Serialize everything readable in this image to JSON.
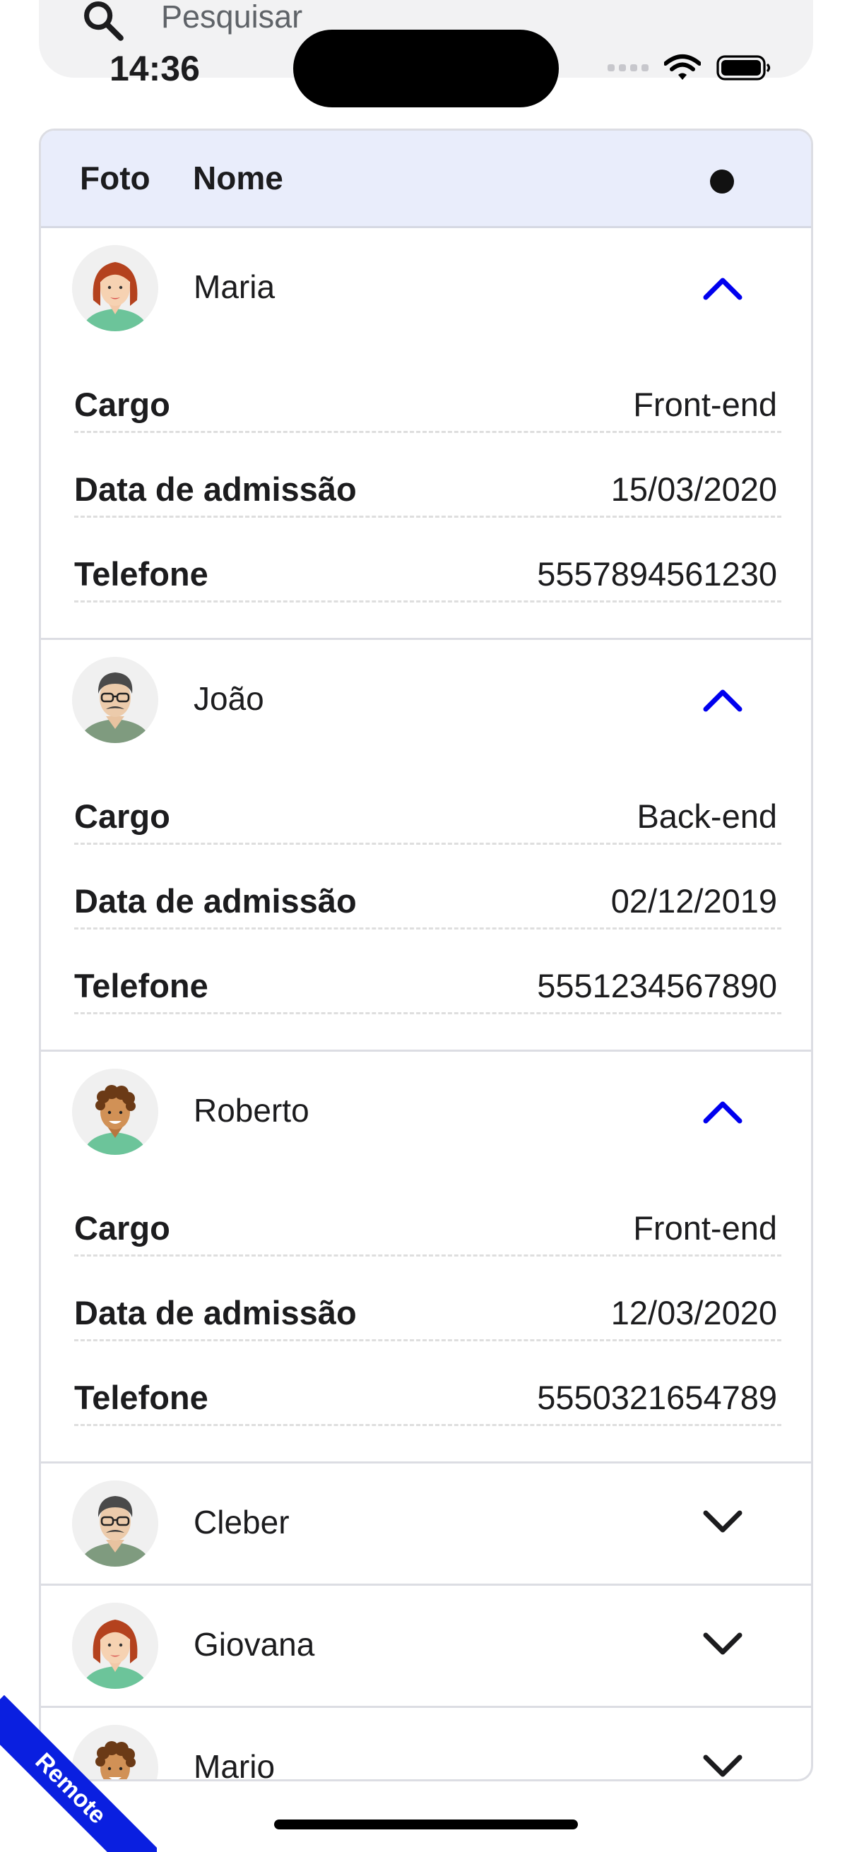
{
  "search": {
    "placeholder": "Pesquisar"
  },
  "status_bar": {
    "time": "14:36"
  },
  "table": {
    "headers": {
      "photo": "Foto",
      "name": "Nome"
    },
    "employees": [
      {
        "name": "Maria",
        "expanded": true,
        "avatar": "woman-red-hair",
        "details": [
          {
            "label": "Cargo",
            "value": "Front-end"
          },
          {
            "label": "Data de admissão",
            "value": "15/03/2020"
          },
          {
            "label": "Telefone",
            "value": "5557894561230"
          }
        ]
      },
      {
        "name": "João",
        "expanded": true,
        "avatar": "man-glasses-mustache",
        "details": [
          {
            "label": "Cargo",
            "value": "Back-end"
          },
          {
            "label": "Data de admissão",
            "value": "02/12/2019"
          },
          {
            "label": "Telefone",
            "value": "5551234567890"
          }
        ]
      },
      {
        "name": "Roberto",
        "expanded": true,
        "avatar": "man-curly-hair",
        "details": [
          {
            "label": "Cargo",
            "value": "Front-end"
          },
          {
            "label": "Data de admissão",
            "value": "12/03/2020"
          },
          {
            "label": "Telefone",
            "value": "5550321654789"
          }
        ]
      },
      {
        "name": "Cleber",
        "expanded": false,
        "avatar": "man-glasses-mustache"
      },
      {
        "name": "Giovana",
        "expanded": false,
        "avatar": "woman-red-hair"
      },
      {
        "name": "Mario",
        "expanded": false,
        "avatar": "man-curly-hair"
      }
    ]
  },
  "ribbon": {
    "label": "Remote"
  },
  "colors": {
    "accent_blue": "#0000ee",
    "header_bg": "#e9edfb",
    "ribbon": "#0a1fe0"
  }
}
